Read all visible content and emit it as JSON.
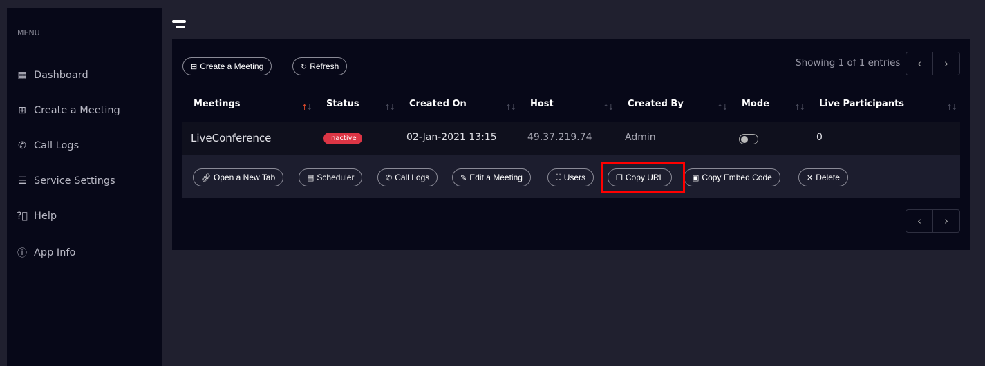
{
  "sidebar": {
    "menu_label": "MENU",
    "items": [
      {
        "label": "Dashboard",
        "icon": "dashboard-icon"
      },
      {
        "label": "Create a Meeting",
        "icon": "folder-plus-icon"
      },
      {
        "label": "Call Logs",
        "icon": "phone-icon"
      },
      {
        "label": "Service Settings",
        "icon": "sliders-icon"
      },
      {
        "label": "Help",
        "icon": "help-circle-icon"
      },
      {
        "label": "App Info",
        "icon": "info-icon"
      }
    ]
  },
  "toolbar": {
    "create_label": "Create a Meeting",
    "refresh_label": "Refresh",
    "showing": "Showing 1 of 1 entries"
  },
  "table": {
    "headers": [
      "Meetings",
      "Status",
      "Created On",
      "Host",
      "Created By",
      "Mode",
      "Live Participants"
    ],
    "rows": [
      {
        "meeting": "LiveConference",
        "status": "Inactive",
        "created_on": "02-Jan-2021 13:15",
        "host": "49.37.219.74",
        "created_by": "Admin",
        "mode_on": false,
        "live_participants": "0"
      }
    ]
  },
  "actions": [
    "Open a New Tab",
    "Scheduler",
    "Call Logs",
    "Edit a Meeting",
    "Users",
    "Copy URL",
    "Copy Embed Code",
    "Delete"
  ],
  "colors": {
    "status_inactive": "#dc3545",
    "highlight": "#ff0000",
    "sort_active": "#e04a2a"
  }
}
